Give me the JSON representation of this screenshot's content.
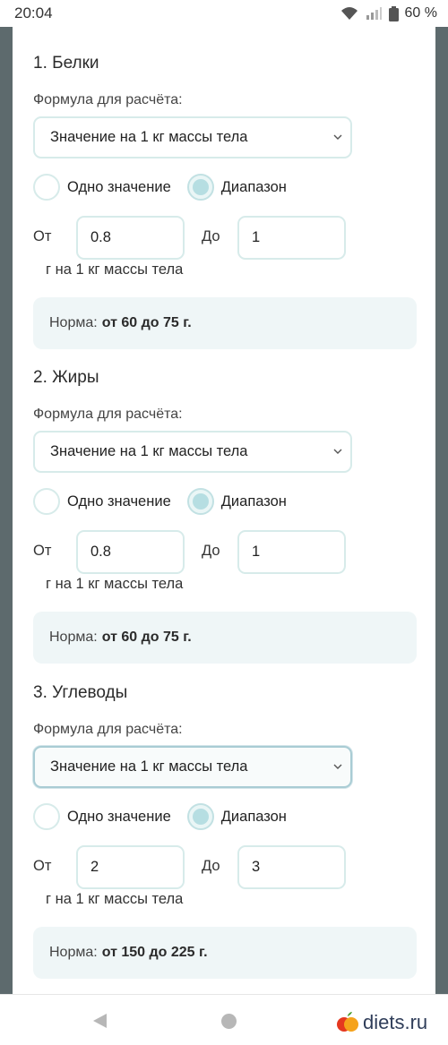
{
  "status": {
    "time": "20:04",
    "battery": "60 %"
  },
  "sections": [
    {
      "title": "1. Белки",
      "formula_label": "Формула для расчёта:",
      "select_value": "Значение на 1 кг массы тела",
      "radio_single": "Одно значение",
      "radio_range": "Диапазон",
      "from_label": "От",
      "from_value": "0.8",
      "to_label": "До",
      "to_value": "1",
      "unit": "г на 1 кг массы тела",
      "norm_label": "Норма:",
      "norm_value": "от 60 до 75 г."
    },
    {
      "title": "2. Жиры",
      "formula_label": "Формула для расчёта:",
      "select_value": "Значение на 1 кг массы тела",
      "radio_single": "Одно значение",
      "radio_range": "Диапазон",
      "from_label": "От",
      "from_value": "0.8",
      "to_label": "До",
      "to_value": "1",
      "unit": "г на 1 кг массы тела",
      "norm_label": "Норма:",
      "norm_value": "от 60 до 75 г."
    },
    {
      "title": "3. Углеводы",
      "formula_label": "Формула для расчёта:",
      "select_value": "Значение на 1 кг массы тела",
      "radio_single": "Одно значение",
      "radio_range": "Диапазон",
      "from_label": "От",
      "from_value": "2",
      "to_label": "До",
      "to_value": "3",
      "unit": "г на 1 кг массы тела",
      "norm_label": "Норма:",
      "norm_value": "от 150 до 225 г."
    }
  ],
  "watermark": {
    "text": "diets.ru"
  },
  "icons": [
    "wifi-icon",
    "signal-icon",
    "battery-icon",
    "chevron-down-icon",
    "back-icon",
    "home-icon",
    "apple-logo-icon"
  ]
}
